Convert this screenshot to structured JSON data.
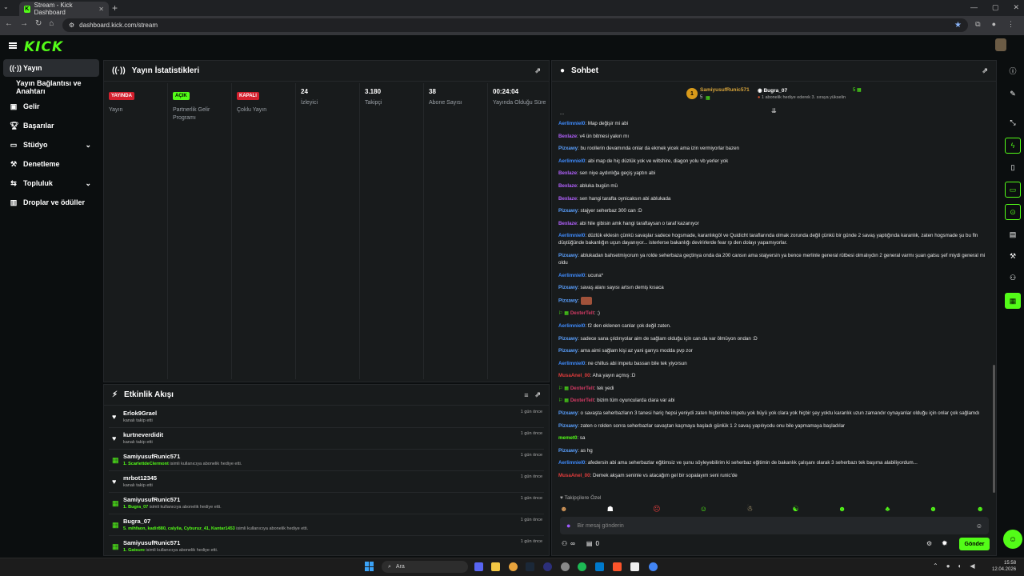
{
  "browser": {
    "tab_title": "Stream - Kick Dashboard",
    "url": "dashboard.kick.com/stream"
  },
  "brand": {
    "logo": "KICK",
    "accent": "#53fc18"
  },
  "sidebar": {
    "items": [
      {
        "label": "Yayın",
        "icon": "broadcast-icon"
      },
      {
        "label": "Yayın Bağlantısı ve Anahtarı",
        "icon": ""
      },
      {
        "label": "Gelir",
        "icon": "revenue-icon"
      },
      {
        "label": "Başarılar",
        "icon": "trophy-icon"
      },
      {
        "label": "Stüdyo",
        "icon": "studio-icon"
      },
      {
        "label": "Denetleme",
        "icon": "wrench-icon"
      },
      {
        "label": "Topluluk",
        "icon": "community-icon"
      },
      {
        "label": "Droplar ve ödüller",
        "icon": "drops-icon"
      }
    ]
  },
  "stats": {
    "title": "Yayın İstatistikleri",
    "columns": [
      {
        "value": "YAYINDA",
        "label": "Yayın",
        "kind": "badge-red"
      },
      {
        "value": "AÇIK",
        "label": "Partnerlik Gelir Programı",
        "kind": "badge-green"
      },
      {
        "value": "KAPALI",
        "label": "Çoklu Yayın",
        "kind": "badge-red"
      },
      {
        "value": "24",
        "label": "İzleyici",
        "kind": "text"
      },
      {
        "value": "3.180",
        "label": "Takipçi",
        "kind": "text"
      },
      {
        "value": "38",
        "label": "Abone Sayısı",
        "kind": "text"
      },
      {
        "value": "00:24:04",
        "label": "Yayında Olduğu Süre",
        "kind": "text"
      }
    ]
  },
  "activity": {
    "title": "Etkinlik Akışı",
    "items": [
      {
        "name": "Erlok9Grael",
        "desc": "kanalı takip etti",
        "highlight": "",
        "time": "1 gün önce",
        "type": "follow"
      },
      {
        "name": "kurtneverdidit",
        "desc": "kanalı takip etti",
        "highlight": "",
        "time": "1 gün önce",
        "type": "follow"
      },
      {
        "name": "SamiyusufRunic571",
        "desc": " isimli kullanıcıya abonelik hediye etti.",
        "highlight": "1. ScarlettdeClermont",
        "time": "1 gün önce",
        "type": "gift"
      },
      {
        "name": "mrbot12345",
        "desc": "kanalı takip etti",
        "highlight": "",
        "time": "1 gün önce",
        "type": "follow"
      },
      {
        "name": "SamiyusufRunic571",
        "desc": " isimli kullanıcıya abonelik hediye etti.",
        "highlight": "1. Bugra_07",
        "time": "1 gün önce",
        "type": "gift"
      },
      {
        "name": "Bugra_07",
        "desc": " isimli kullanıcıya abonelik hediye etti.",
        "highlight": "5. mihfaon, kadir880, calylia, Cyburuz_41, Kantar1453",
        "time": "1 gün önce",
        "type": "gift"
      },
      {
        "name": "SamiyusufRunic571",
        "desc": " isimli kullanıcıya abonelik hediye etti.",
        "highlight": "1. Gatsure",
        "time": "1 gün önce",
        "type": "gift"
      }
    ]
  },
  "chat": {
    "title": "Sohbet",
    "pinned": {
      "rank": "1",
      "user1": "SamiyusufRunic571",
      "user1_count": "5",
      "user2": "Bugra_07",
      "user2_count": "5",
      "note": "1 abonelik hediye ederek 3. sıraya yükselin"
    },
    "messages": [
      {
        "user": "Aerlimniel0",
        "color": "blue",
        "text": "Map değişir mi abi"
      },
      {
        "user": "Bexlaze",
        "color": "purple",
        "text": "v4 ün bitmesi yakın mı"
      },
      {
        "user": "Pizxawy",
        "color": "lblue",
        "text": "bu roollerin devamında onlar da ekmek yicek ama izin vermiyorlar bazen"
      },
      {
        "user": "Aerlimniel0",
        "color": "blue",
        "text": "abi map de hiç düzlük yok ve wiltshire, diagon yolu vb yerler yok"
      },
      {
        "user": "Bexlaze",
        "color": "purple",
        "text": "sen niye aydınlığa geçiş yaptın abi"
      },
      {
        "user": "Bexlaze",
        "color": "purple",
        "text": "abluka bugün mü"
      },
      {
        "user": "Bexlaze",
        "color": "purple",
        "text": "sen hangi tarafta oynicaksın abi ablukada"
      },
      {
        "user": "Pizxawy",
        "color": "lblue",
        "text": "stajyer seherbaz 300 can :D"
      },
      {
        "user": "Bexlaze",
        "color": "purple",
        "text": "abi hile gibisin amk hangi taraftaysan o taraf kazanıyor"
      },
      {
        "user": "Aerlimniel0",
        "color": "blue",
        "text": "düzlük eklesin çünkü savaşlar sadece hogsmade, karanlıkgöl ve Quidicht taraflarında olmak zorunda değil çünkü bir günde 2 savaş yaptığında karanlık, zaten hogsmade şu bu fln düştüğünde bakanlığın uçun dayanıyor... isterlerse bakanlığı devirirlerde fear rp den dolayı yapamıyorlar."
      },
      {
        "user": "Pizxawy",
        "color": "lblue",
        "text": "ablukadan bahsetmiyorum ya rolde seherbaza geçtinya onda da 200 cansın ama stajyersin ya bence merlinle general rütbesi olmalıydın 2 general varmı şuan gatsu şef miydi general mi oldu"
      },
      {
        "user": "Aerlimniel0",
        "color": "blue",
        "text": "ucuna*"
      },
      {
        "user": "Pizxawy",
        "color": "lblue",
        "text": "savaş alanı sayısı artsın demiş kısaca"
      },
      {
        "user": "Pizxawy",
        "color": "lblue",
        "text": "[emote]"
      },
      {
        "user": "DexterTelt",
        "color": "pink",
        "text": ";)"
      },
      {
        "user": "Aerlimniel0",
        "color": "blue",
        "text": "f2 den eklenen canlar çok değil zaten."
      },
      {
        "user": "Pizxawy",
        "color": "lblue",
        "text": "sadece sana çıldırıyolar aim de sağlam olduğu için can da var ölmüyon ondan :D"
      },
      {
        "user": "Pizxawy",
        "color": "lblue",
        "text": "ama aimi sağlam kişi az yani garrys modda pvp zor"
      },
      {
        "user": "Aerlimniel0",
        "color": "blue",
        "text": "ne chillus abi impetu bassan bile tek yiyorsun"
      },
      {
        "user": "MusaAnel_00",
        "color": "red",
        "text": "Aha yayın açmış :D"
      },
      {
        "user": "DexterTelt",
        "color": "pink",
        "text": "tek yedi"
      },
      {
        "user": "DexterTelt",
        "color": "pink",
        "text": "bizim tüm oyuncularda clara var abi"
      },
      {
        "user": "Pizxawy",
        "color": "lblue",
        "text": "o savaşta seherbazların 3 tanesi hariç hepsi yeniydi zaten hiçbirinde impetu yok büyü yok clara yok hiçbir şey yoktu karanlık uzun zamandır oynayanlar olduğu için onlar çok sağlamdı"
      },
      {
        "user": "Pizxawy",
        "color": "lblue",
        "text": "zaten o rolden sonra seherbazlar savaştan kaçmaya başladı günlük 1 2 savaş yapılıyodu onu bile yapmamaya başladılar"
      },
      {
        "user": "memet0",
        "color": "green",
        "text": "sa"
      },
      {
        "user": "Pizxawy",
        "color": "lblue",
        "text": "as hg"
      },
      {
        "user": "Aerlimniel0",
        "color": "blue",
        "text": "afedersin abi ama seherbazlar eğitimsiz ve şunu söyleyebilirim ki seherbaz eğitimin de bakanlık çalışanı olarak 3 seherbazı tek başıma alabiliyordum..."
      },
      {
        "user": "MusaAnel_00",
        "color": "red",
        "text": "Demek akşam seninle vs atacağım gel bir sopalayım seni runic'de"
      }
    ],
    "followers_label": "Takipçilere Özel",
    "input_placeholder": "Bir mesaj gönderin",
    "send_label": "Gönder",
    "infinity_label": "∞",
    "gift_count": "0"
  },
  "taskbar": {
    "search_placeholder": "Ara",
    "time": "15:58",
    "date": "12.04.2026"
  }
}
